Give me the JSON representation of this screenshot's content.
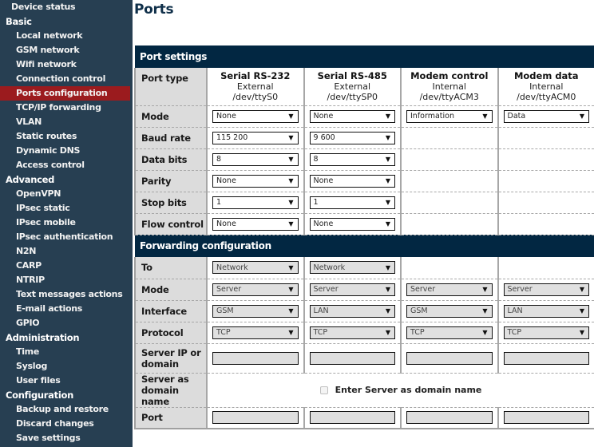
{
  "sidebar": {
    "device_status": "Device status",
    "sections": [
      {
        "title": "Basic",
        "items": [
          "Local network",
          "GSM network",
          "Wifi network",
          "Connection control",
          "Ports configuration",
          "TCP/IP forwarding",
          "VLAN",
          "Static routes",
          "Dynamic DNS",
          "Access control"
        ]
      },
      {
        "title": "Advanced",
        "items": [
          "OpenVPN",
          "IPsec static",
          "IPsec mobile",
          "IPsec authentication",
          "N2N",
          "CARP",
          "NTRIP",
          "Text messages actions",
          "E-mail actions",
          "GPIO"
        ]
      },
      {
        "title": "Administration",
        "items": [
          "Time",
          "Syslog",
          "User files"
        ]
      },
      {
        "title": "Configuration",
        "items": [
          "Backup and restore",
          "Discard changes",
          "Save settings"
        ]
      }
    ],
    "active_item": "Ports configuration"
  },
  "page": {
    "title": "Ports"
  },
  "port_settings": {
    "title": "Port settings",
    "port_type_label": "Port type",
    "ports": [
      {
        "name": "Serial RS-232",
        "location": "External",
        "device": "/dev/ttyS0"
      },
      {
        "name": "Serial RS-485",
        "location": "External",
        "device": "/dev/ttySP0"
      },
      {
        "name": "Modem control",
        "location": "Internal",
        "device": "/dev/ttyACM3"
      },
      {
        "name": "Modem data",
        "location": "Internal",
        "device": "/dev/ttyACM0"
      }
    ],
    "rows": [
      {
        "label": "Mode",
        "values": [
          "None",
          "None",
          "Information",
          "Data"
        ]
      },
      {
        "label": "Baud rate",
        "values": [
          "115 200",
          "9 600",
          null,
          null
        ]
      },
      {
        "label": "Data bits",
        "values": [
          "8",
          "8",
          null,
          null
        ]
      },
      {
        "label": "Parity",
        "values": [
          "None",
          "None",
          null,
          null
        ]
      },
      {
        "label": "Stop bits",
        "values": [
          "1",
          "1",
          null,
          null
        ]
      },
      {
        "label": "Flow control",
        "values": [
          "None",
          "None",
          null,
          null
        ]
      }
    ]
  },
  "forwarding": {
    "title": "Forwarding configuration",
    "rows": [
      {
        "label": "To",
        "values": [
          "Network",
          "Network",
          null,
          null
        ]
      },
      {
        "label": "Mode",
        "values": [
          "Server",
          "Server",
          "Server",
          "Server"
        ]
      },
      {
        "label": "Interface",
        "values": [
          "GSM",
          "LAN",
          "GSM",
          "LAN"
        ]
      },
      {
        "label": "Protocol",
        "values": [
          "TCP",
          "TCP",
          "TCP",
          "TCP"
        ]
      }
    ],
    "server_ip_label": "Server IP or domain",
    "server_ip_values": [
      "",
      "",
      "",
      ""
    ],
    "server_as_domain_label": "Server as domain name",
    "server_as_domain_checkbox_label": "Enter Server as domain name",
    "server_as_domain_checked": false,
    "port_label": "Port",
    "port_values": [
      "",
      "",
      "",
      ""
    ]
  },
  "icons": {
    "dropdown_arrow": "▼"
  }
}
